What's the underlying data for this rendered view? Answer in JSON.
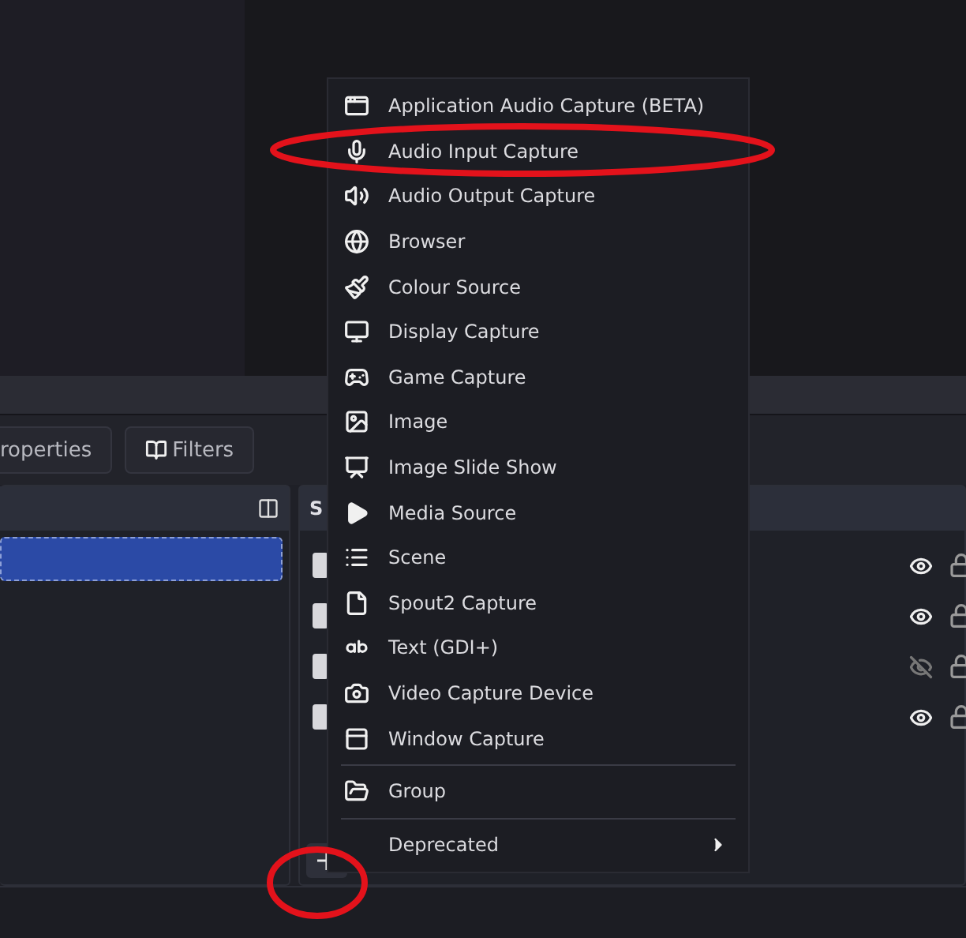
{
  "controls_toolbar": {
    "buttons": [
      {
        "label": "roperties"
      },
      {
        "label": "Filters"
      }
    ]
  },
  "scenes_panel": {
    "rows": [
      {
        "selected": true
      }
    ]
  },
  "sources_panel": {
    "title": "S",
    "rows": [
      {
        "visible": true
      },
      {
        "visible": true
      },
      {
        "visible": false
      },
      {
        "visible": true
      }
    ]
  },
  "add_source_menu": {
    "items": [
      {
        "label": "Application Audio Capture (BETA)",
        "separator_before": false,
        "has_submenu": false
      },
      {
        "label": "Audio Input Capture",
        "separator_before": false,
        "has_submenu": false
      },
      {
        "label": "Audio Output Capture",
        "separator_before": false,
        "has_submenu": false
      },
      {
        "label": "Browser",
        "separator_before": false,
        "has_submenu": false
      },
      {
        "label": "Colour Source",
        "separator_before": false,
        "has_submenu": false
      },
      {
        "label": "Display Capture",
        "separator_before": false,
        "has_submenu": false
      },
      {
        "label": "Game Capture",
        "separator_before": false,
        "has_submenu": false
      },
      {
        "label": "Image",
        "separator_before": false,
        "has_submenu": false
      },
      {
        "label": "Image Slide Show",
        "separator_before": false,
        "has_submenu": false
      },
      {
        "label": "Media Source",
        "separator_before": false,
        "has_submenu": false
      },
      {
        "label": "Scene",
        "separator_before": false,
        "has_submenu": false
      },
      {
        "label": "Spout2 Capture",
        "separator_before": false,
        "has_submenu": false
      },
      {
        "label": "Text (GDI+)",
        "separator_before": false,
        "has_submenu": false
      },
      {
        "label": "Video Capture Device",
        "separator_before": false,
        "has_submenu": false
      },
      {
        "label": "Window Capture",
        "separator_before": false,
        "has_submenu": false
      },
      {
        "label": "Group",
        "separator_before": true,
        "has_submenu": false
      },
      {
        "label": "Deprecated",
        "separator_before": true,
        "has_submenu": true
      }
    ]
  }
}
